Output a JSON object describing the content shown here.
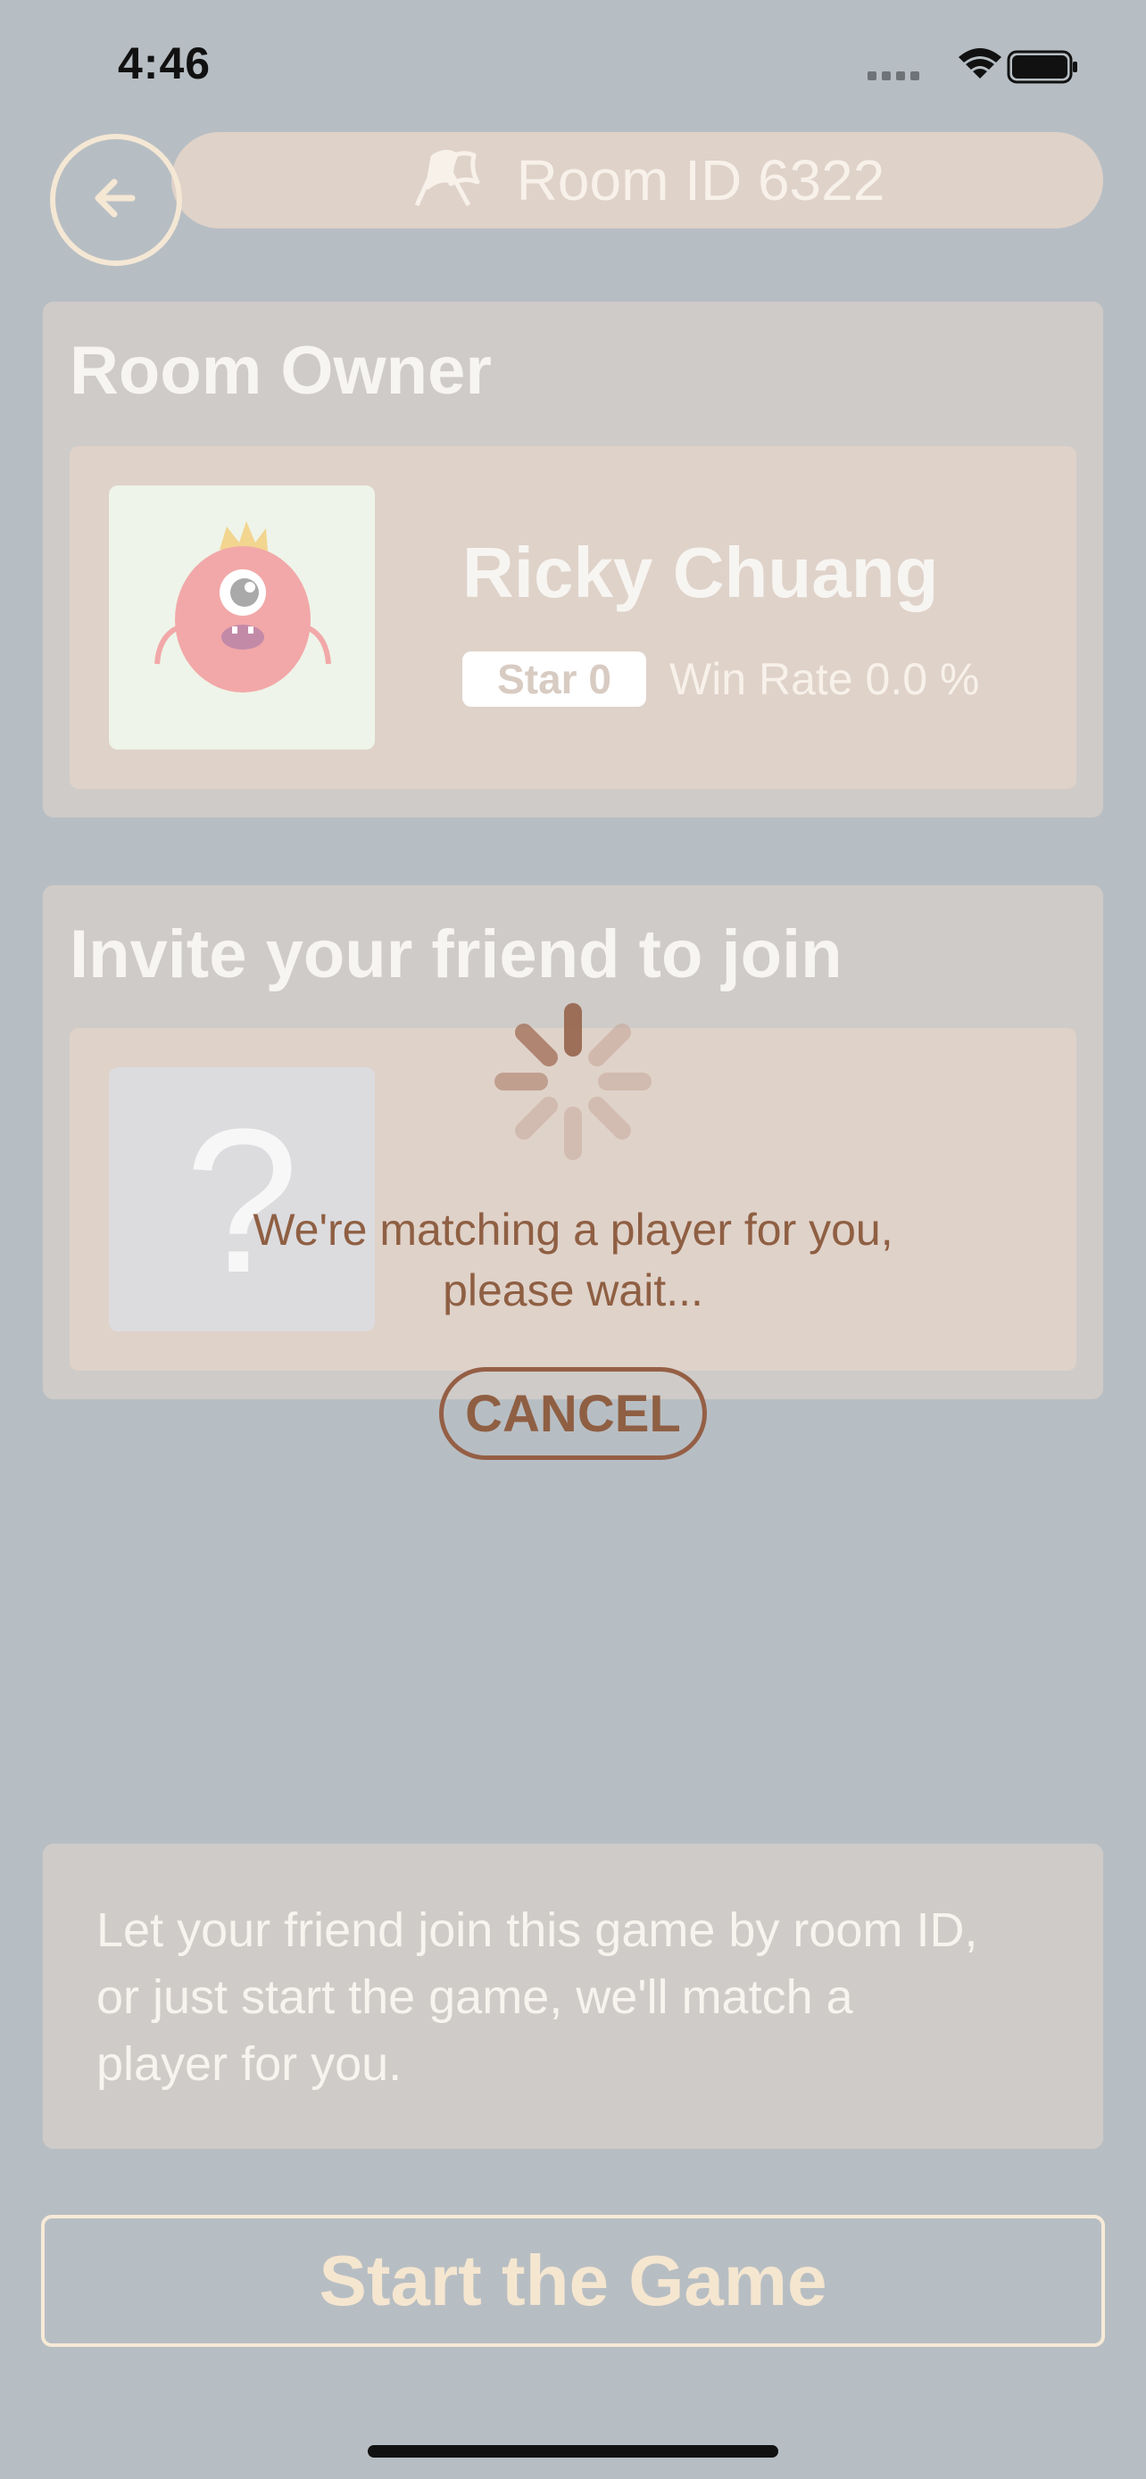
{
  "status_bar": {
    "time": "4:46"
  },
  "header": {
    "room_label": "Room ID 6322"
  },
  "owner_section": {
    "title": "Room Owner",
    "name": "Ricky Chuang",
    "star": "Star 0",
    "win_rate": "Win Rate 0.0 %"
  },
  "invite_section": {
    "title": "Invite your friend to join",
    "unknown_mark": "?"
  },
  "overlay": {
    "line1": "We're matching a player for you,",
    "line2": "please wait...",
    "cancel_label": "CANCEL"
  },
  "info": {
    "line1": "Let your friend join this game by room ID,",
    "line2": "or just start the game, we'll match a",
    "line3": "player for you."
  },
  "start_button": {
    "label": "Start the Game"
  },
  "colors": {
    "background": "#b7bec3",
    "accent_brown": "#8f5f43",
    "cream": "#f5e6d0"
  }
}
